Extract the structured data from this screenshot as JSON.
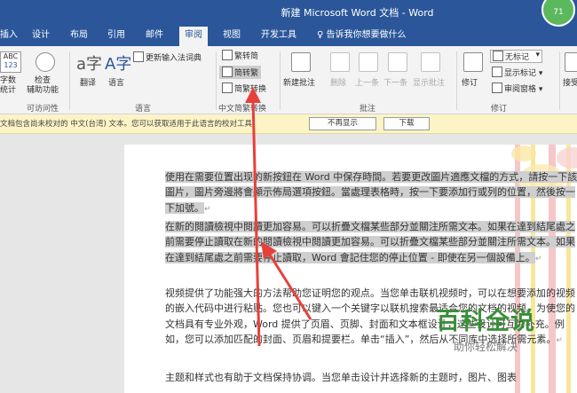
{
  "window": {
    "title": "新建 Microsoft Word 文档  -  Word",
    "badge": "71"
  },
  "tabs": [
    {
      "label": "插入"
    },
    {
      "label": "设计"
    },
    {
      "label": "布局"
    },
    {
      "label": "引用"
    },
    {
      "label": "邮件"
    },
    {
      "label": "审阅"
    },
    {
      "label": "视图"
    },
    {
      "label": "开发工具"
    },
    {
      "label": "告诉我你想要做什么"
    }
  ],
  "ribbon": {
    "proofing": {
      "abc": "ABC",
      "num": "123",
      "abc_label": "字数\n统计",
      "check_label": "检查\n辅助功能",
      "group": "可访问性"
    },
    "language": {
      "translate": "翻译",
      "lang": "语言",
      "update_ime": "更新输入法词典",
      "group": "语言"
    },
    "chinese": {
      "t2s": "繁转简",
      "s2t": "简转繁",
      "convert": "简繁转换",
      "group": "中文简繁转换"
    },
    "comments": {
      "new": "新建批注",
      "delete": "删除",
      "prev": "上一条",
      "next": "下一条",
      "show": "显示批注",
      "group": "批注"
    },
    "tracking": {
      "track": "修订",
      "markup": "无标记",
      "show_markup": "显示标记",
      "pane": "审阅窗格",
      "group": "修订"
    },
    "changes": {
      "accept": "接受"
    }
  },
  "infobar": {
    "message": "文档包含尚未校对的 中文(台湾) 文本。您可以获取适用于此语言的校对工具。",
    "dont_show": "不再显示",
    "download": "下载"
  },
  "document": {
    "paragraphs": [
      "使用在需要位置出现的新按鈕在 Word 中保存時間。若要更改圖片適應文檔的方式，請按一下該圖片，圖片旁邊將會顯示佈局選項按鈕。當處理表格時，按一下要添加行或列的位置，然後按一下加號。",
      "在新的閱讀檢視中閱讀更加容易。可以折疊文檔某些部分並關注所需文本。如果在達到結尾處之前需要停止讀取在新的閱讀檢視中閱讀更加容易。可以折疊文檔某些部分並關注所需文本。如果在達到結尾處之前需要停止讀取，Word 會記住您的停止位置 - 即使在另一個設備上。",
      "视频提供了功能强大的方法帮助您证明您的观点。当您单击联机视频时，可以在想要添加的视频的嵌入代码中进行粘贴。您也可以键入一个关键字以联机搜索最适合您的文档的视频。为使您的文档具有专业外观，Word 提供了页眉、页脚、封面和文本框设计，这些设计可互为补充。例如，您可以添加匹配的封面、页眉和提要栏。单击“插入”，然后从不同库中选择所需元素。",
      "主题和样式也有助于文档保持协调。当您单击设计并选择新的主题时，图片、图表"
    ]
  },
  "watermark": {
    "title": "百科全说",
    "subtitle": "助你轻松解决"
  }
}
